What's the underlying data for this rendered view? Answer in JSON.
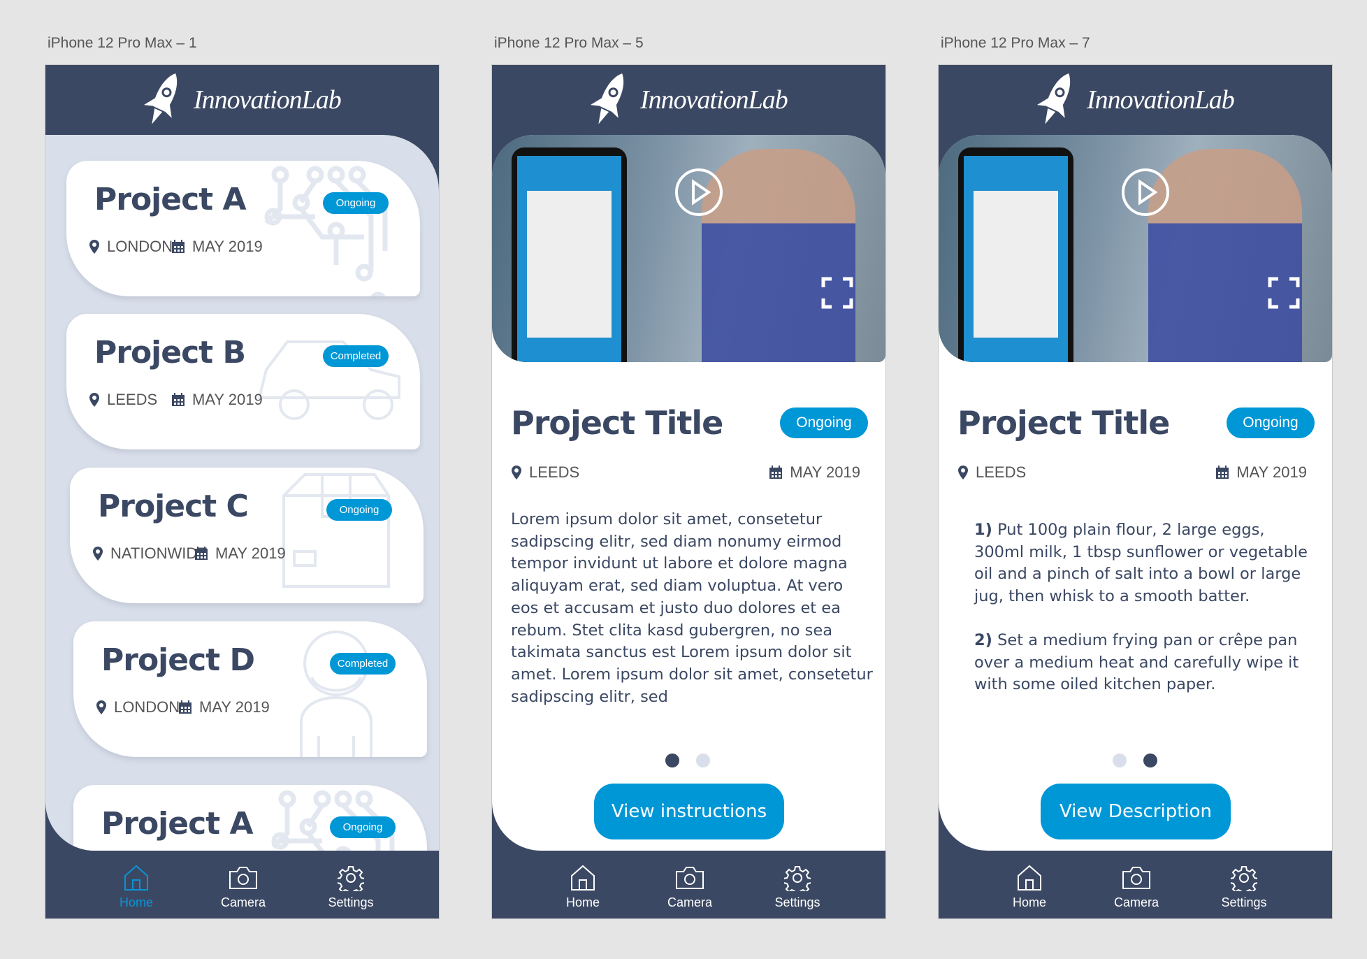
{
  "colors": {
    "navy": "#3b4863",
    "accent": "#0097d7",
    "light_bg": "#d9dfea"
  },
  "screens": [
    {
      "label": "iPhone 12 Pro Max – 1"
    },
    {
      "label": "iPhone 12 Pro Max – 5"
    },
    {
      "label": "iPhone 12 Pro Max – 7"
    }
  ],
  "logo": {
    "text": "InnovationLab",
    "icon": "rocket-icon"
  },
  "nav": {
    "items": [
      {
        "label": "Home",
        "icon": "home-icon"
      },
      {
        "label": "Camera",
        "icon": "camera-icon"
      },
      {
        "label": "Settings",
        "icon": "gear-icon"
      }
    ]
  },
  "home": {
    "active_nav": "Home",
    "cards": [
      {
        "title": "Project A",
        "status": "Ongoing",
        "location": "LONDON",
        "date": "MAY 2019",
        "illustration": "circuit-brain"
      },
      {
        "title": "Project B",
        "status": "Completed",
        "location": "LEEDS",
        "date": "MAY 2019",
        "illustration": "car"
      },
      {
        "title": "Project C",
        "status": "Ongoing",
        "location": "NATIONWIDE",
        "date": "MAY 2019",
        "illustration": "parcel-box"
      },
      {
        "title": "Project D",
        "status": "Completed",
        "location": "LONDON",
        "date": "MAY 2019",
        "illustration": "person"
      },
      {
        "title": "Project A",
        "status": "Ongoing",
        "location": "",
        "date": "",
        "illustration": "circuit-brain"
      }
    ]
  },
  "detail_description": {
    "title": "Project Title",
    "status": "Ongoing",
    "location": "LEEDS",
    "date": "MAY 2019",
    "body": "Lorem ipsum dolor sit amet, consetetur sadipscing elitr, sed diam nonumy eirmod tempor invidunt ut labore et dolore magna aliquyam erat, sed diam voluptua. At vero eos et accusam et justo duo dolores et ea rebum. Stet clita kasd gubergren, no sea takimata sanctus est Lorem ipsum dolor sit amet. Lorem ipsum dolor sit amet, consetetur sadipscing elitr, sed",
    "page": 1,
    "pages": 2,
    "button": "View instructions"
  },
  "detail_instructions": {
    "title": "Project Title",
    "status": "Ongoing",
    "location": "LEEDS",
    "date": "MAY 2019",
    "steps": [
      {
        "num": "1)",
        "text": "Put 100g plain flour, 2 large eggs, 300ml milk, 1 tbsp sunflower or vegetable oil and a pinch of salt into a bowl or large jug, then whisk to a smooth batter."
      },
      {
        "num": "2)",
        "text": "Set a medium frying pan or crêpe pan over a medium heat and carefully wipe it with some oiled kitchen paper."
      }
    ],
    "page": 2,
    "pages": 2,
    "button": "View Description"
  }
}
